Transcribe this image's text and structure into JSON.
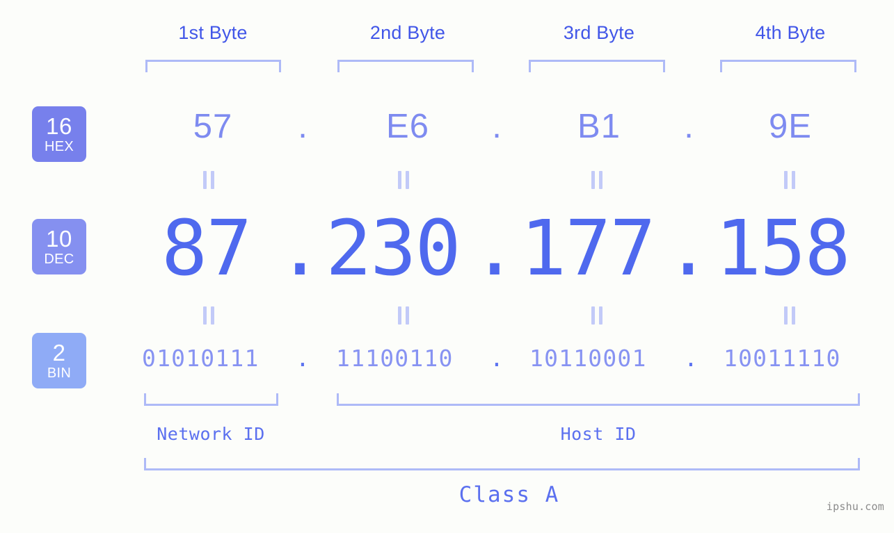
{
  "meta": {
    "watermark": "ipshu.com",
    "background_color": "#fcfdfa"
  },
  "colors": {
    "header_text": "#4156e8",
    "bracket": "#aebaf7",
    "hex_text": "#7e8bf0",
    "dec_text": "#4f69ee",
    "bin_text": "#8793f2",
    "label_text": "#5b70ef",
    "badge_hex": "#7780ec",
    "badge_dec": "#8590f0",
    "badge_bin": "#8fabf6",
    "equals_mark": "#c2caf8"
  },
  "byte_headers": [
    {
      "label": "1st Byte"
    },
    {
      "label": "2nd Byte"
    },
    {
      "label": "3rd Byte"
    },
    {
      "label": "4th Byte"
    }
  ],
  "bases": [
    {
      "number": "16",
      "name": "HEX"
    },
    {
      "number": "10",
      "name": "DEC"
    },
    {
      "number": "2",
      "name": "BIN"
    }
  ],
  "separator": ".",
  "rows": {
    "hex": {
      "base": "16",
      "base_name": "HEX",
      "values": [
        "57",
        "E6",
        "B1",
        "9E"
      ]
    },
    "dec": {
      "base": "10",
      "base_name": "DEC",
      "values": [
        "87",
        "230",
        "177",
        "158"
      ]
    },
    "bin": {
      "base": "2",
      "base_name": "BIN",
      "values": [
        "01010111",
        "11100110",
        "10110001",
        "10011110"
      ]
    }
  },
  "segments": {
    "network_id": "Network ID",
    "host_id": "Host ID"
  },
  "class": "Class A"
}
